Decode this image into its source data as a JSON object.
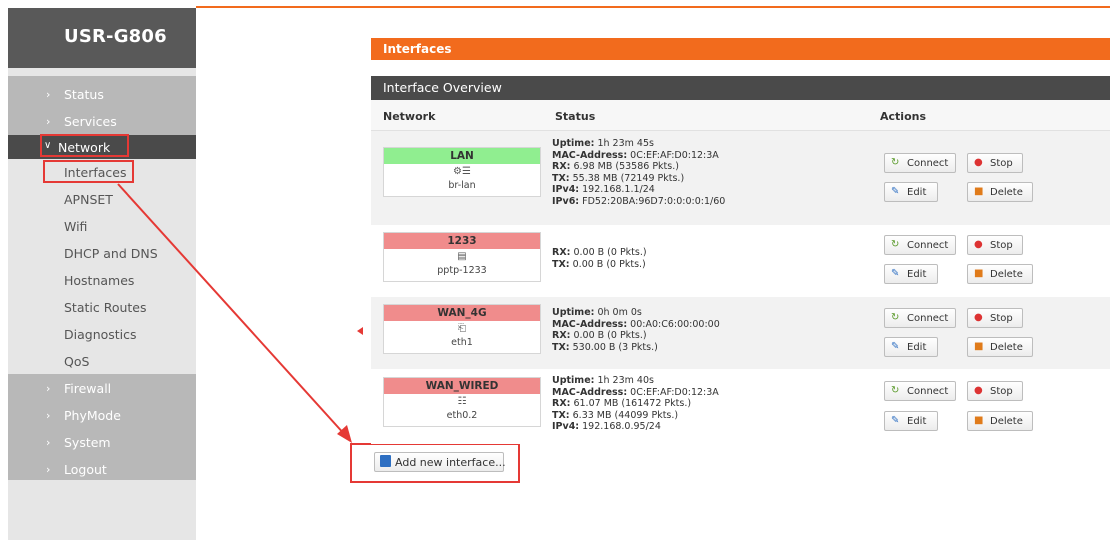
{
  "brand": "USR-G806",
  "menu": {
    "status": "Status",
    "services": "Services",
    "network": "Network",
    "submenu": [
      "Interfaces",
      "APNSET",
      "Wifi",
      "DHCP and DNS",
      "Hostnames",
      "Static Routes",
      "Diagnostics",
      "QoS"
    ],
    "firewall": "Firewall",
    "phymode": "PhyMode",
    "system": "System",
    "logout": "Logout"
  },
  "page": {
    "title": "Interfaces",
    "section": "Interface Overview",
    "columns": [
      "Network",
      "Status",
      "Actions"
    ]
  },
  "buttons": {
    "connect": "Connect",
    "stop": "Stop",
    "edit": "Edit",
    "delete": "Delete",
    "add": "Add new interface..."
  },
  "interfaces": [
    {
      "name": "LAN",
      "color": "#90ee90",
      "icon": "bridge-icon",
      "device": "br-lan",
      "status": [
        [
          "Uptime:",
          " 1h 23m 45s"
        ],
        [
          "MAC-Address:",
          " 0C:EF:AF:D0:12:3A"
        ],
        [
          "RX:",
          " 6.98 MB (53586 Pkts.)"
        ],
        [
          "TX:",
          " 55.38 MB (72149 Pkts.)"
        ],
        [
          "IPv4:",
          " 192.168.1.1/24"
        ],
        [
          "IPv6:",
          " FD52:20BA:96D7:0:0:0:0:1/60"
        ]
      ]
    },
    {
      "name": "1233",
      "color": "#f08c8c",
      "icon": "tunnel-icon",
      "device": "pptp-1233",
      "status": [
        [
          "RX:",
          " 0.00 B (0 Pkts.)"
        ],
        [
          "TX:",
          " 0.00 B (0 Pkts.)"
        ]
      ]
    },
    {
      "name": "WAN_4G",
      "color": "#f08c8c",
      "icon": "ethernet-icon",
      "device": "eth1",
      "status": [
        [
          "Uptime:",
          " 0h 0m 0s"
        ],
        [
          "MAC-Address:",
          " 00:A0:C6:00:00:00"
        ],
        [
          "RX:",
          " 0.00 B (0 Pkts.)"
        ],
        [
          "TX:",
          " 530.00 B (3 Pkts.)"
        ]
      ]
    },
    {
      "name": "WAN_WIRED",
      "color": "#f08c8c",
      "icon": "switch-icon",
      "device": "eth0.2",
      "status": [
        [
          "Uptime:",
          " 1h 23m 40s"
        ],
        [
          "MAC-Address:",
          " 0C:EF:AF:D0:12:3A"
        ],
        [
          "RX:",
          " 61.07 MB (161472 Pkts.)"
        ],
        [
          "TX:",
          " 6.33 MB (44099 Pkts.)"
        ],
        [
          "IPv4:",
          " 192.168.0.95/24"
        ]
      ]
    }
  ]
}
